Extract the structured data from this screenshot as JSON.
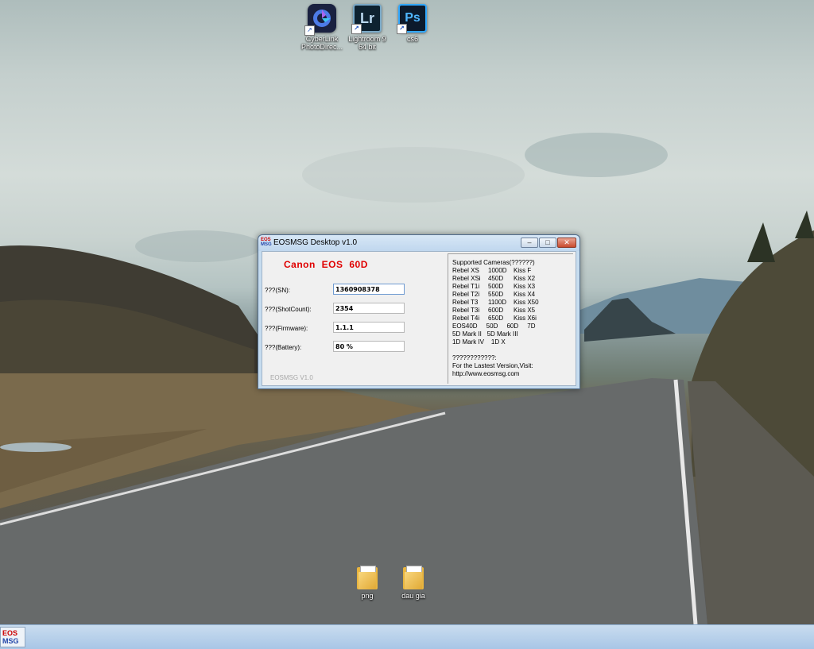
{
  "desktop_icons": [
    {
      "label_line1": "CyberLink",
      "label_line2": "PhotoDirec..."
    },
    {
      "label_line1": "Lightroom 9",
      "label_line2": "64 bit",
      "glyph": "Lr"
    },
    {
      "label_line1": "cs6",
      "glyph": "Ps"
    }
  ],
  "folders": [
    {
      "label": "png"
    },
    {
      "label": "dau gia"
    }
  ],
  "taskbar": {
    "app_line1": "EOS",
    "app_line2": "MSG"
  },
  "window": {
    "title": "EOSMSG Desktop v1.0",
    "icon_line1": "EOS",
    "icon_line2": "MSG",
    "buttons": {
      "minimize": "–",
      "maximize": "□",
      "close": "✕"
    },
    "camera_model": "Canon EOS 60D",
    "fields": [
      {
        "label": "???(SN):",
        "value": "1360908378"
      },
      {
        "label": "???(ShotCount):",
        "value": "2354"
      },
      {
        "label": "???(Firmware):",
        "value": "1.1.1"
      },
      {
        "label": "???(Battery):",
        "value": "80 %"
      }
    ],
    "footer_version": "EOSMSG V1.0",
    "supported_title": "Supported Cameras(??????)",
    "supported_rows": [
      [
        "Rebel XS",
        "1000D",
        "Kiss F"
      ],
      [
        "Rebel XSi",
        "450D",
        "Kiss X2"
      ],
      [
        "Rebel T1i",
        "500D",
        "Kiss X3"
      ],
      [
        "Rebel T2i",
        "550D",
        "Kiss X4"
      ],
      [
        "Rebel T3",
        "1100D",
        "Kiss X50"
      ],
      [
        "Rebel T3i",
        "600D",
        "Kiss X5"
      ],
      [
        "Rebel T4i",
        "650D",
        "Kiss X6i"
      ]
    ],
    "supported_extra": [
      "EOS40D     50D     60D     7D",
      "5D Mark II   5D Mark III",
      "1D Mark IV    1D X"
    ],
    "info_lines": [
      "????????????:",
      "For the Lastest Version,Visit:",
      "http://www.eosmsg.com"
    ]
  },
  "colors": {
    "camera_model": "#e00000",
    "title_bar": "#c6dcef",
    "taskbar": "#a8c6e6"
  }
}
